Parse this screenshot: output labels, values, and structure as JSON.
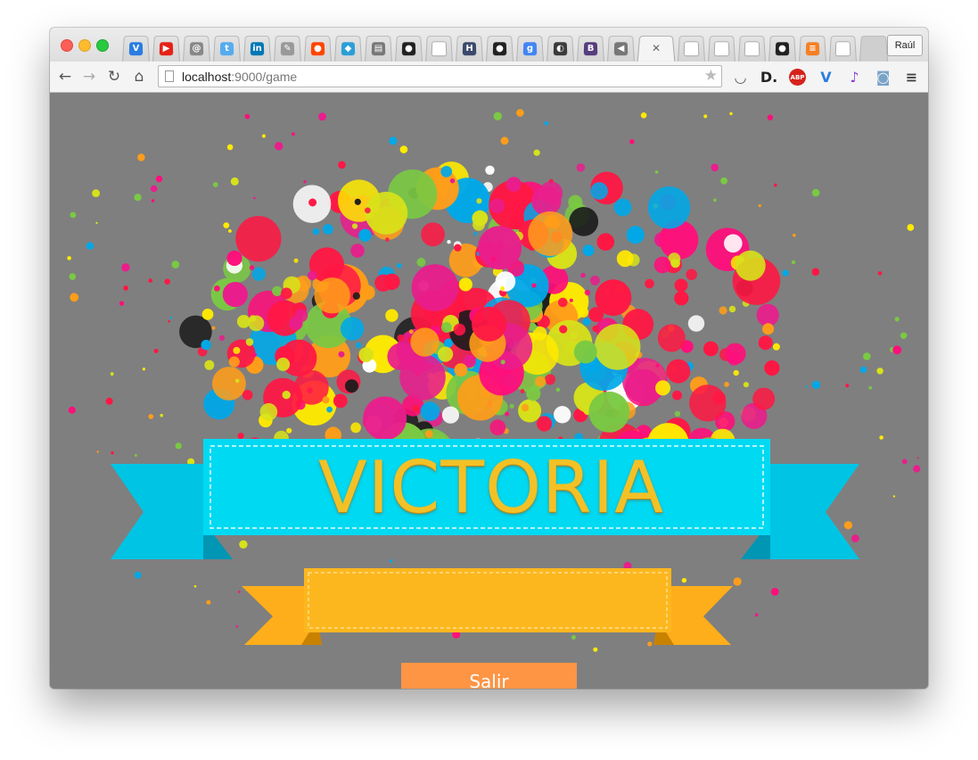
{
  "browser": {
    "profile_name": "Raúl",
    "url": {
      "host": "localhost",
      "path": ":9000/game"
    },
    "tabs": [
      {
        "icon": "v-icon",
        "color": "#2a7de1",
        "glyph": "V"
      },
      {
        "icon": "youtube-icon",
        "color": "#e62117",
        "glyph": "▶"
      },
      {
        "icon": "opera-icon",
        "color": "#888888",
        "glyph": "@"
      },
      {
        "icon": "twitter-icon",
        "color": "#55acee",
        "glyph": "t"
      },
      {
        "icon": "linkedin-icon",
        "color": "#0077b5",
        "glyph": "in"
      },
      {
        "icon": "drawing-icon",
        "color": "#999999",
        "glyph": "✎"
      },
      {
        "icon": "reddit-icon",
        "color": "#ff4500",
        "glyph": "●"
      },
      {
        "icon": "fish-icon",
        "color": "#2a9fd6",
        "glyph": "◆"
      },
      {
        "icon": "printer-icon",
        "color": "#777777",
        "glyph": "▤"
      },
      {
        "icon": "github-icon",
        "color": "#222222",
        "glyph": "●"
      },
      {
        "icon": "blank-page-icon",
        "color": "#cccccc",
        "glyph": ""
      },
      {
        "icon": "h-icon",
        "color": "#3b4a6b",
        "glyph": "H"
      },
      {
        "icon": "github-icon",
        "color": "#222222",
        "glyph": "●"
      },
      {
        "icon": "google-icon",
        "color": "#4285f4",
        "glyph": "g"
      },
      {
        "icon": "circle-icon",
        "color": "#3b3b3b",
        "glyph": "◐"
      },
      {
        "icon": "bootstrap-icon",
        "color": "#563d7c",
        "glyph": "B"
      },
      {
        "icon": "speaker-icon",
        "color": "#777777",
        "glyph": "◀"
      }
    ],
    "tabs_after_active": [
      {
        "icon": "blank-page-icon",
        "color": "#cccccc",
        "glyph": ""
      },
      {
        "icon": "blank-page-icon",
        "color": "#cccccc",
        "glyph": ""
      },
      {
        "icon": "blank-page-icon",
        "color": "#cccccc",
        "glyph": ""
      },
      {
        "icon": "github-icon",
        "color": "#222222",
        "glyph": "●"
      },
      {
        "icon": "stackoverflow-icon",
        "color": "#f48024",
        "glyph": "≡"
      },
      {
        "icon": "blank-page-icon",
        "color": "#cccccc",
        "glyph": ""
      }
    ],
    "extensions": [
      {
        "icon": "pocket-icon",
        "color": "#555555",
        "glyph": "◡"
      },
      {
        "icon": "disqus-icon",
        "color": "#222222",
        "glyph": "D."
      },
      {
        "icon": "adblock-icon",
        "color": "#d5231c",
        "glyph": "ABP"
      },
      {
        "icon": "v-icon",
        "color": "#2a7de1",
        "glyph": "V"
      },
      {
        "icon": "music-note-icon",
        "color": "#8a3fd8",
        "glyph": "♪"
      },
      {
        "icon": "camera-icon",
        "color": "#7aa3c8",
        "glyph": "◙"
      },
      {
        "icon": "menu-icon",
        "color": "#444444",
        "glyph": "≡"
      }
    ]
  },
  "game": {
    "title": "VICTORIA",
    "subtitle": "",
    "exit_label": "Salir",
    "colors": {
      "background": "#7f7f7f",
      "ribbon_top": "#00d9f2",
      "ribbon_bottom": "#fdb71e",
      "title_text": "#f3c126",
      "button": "#fd9545"
    },
    "paint_colors": [
      "#ff1744",
      "#ff0f7b",
      "#ffea00",
      "#d7e21a",
      "#ff9d1a",
      "#00a8e8",
      "#7ac943",
      "#e91e8c",
      "#ffffff",
      "#1b1b1b"
    ]
  }
}
